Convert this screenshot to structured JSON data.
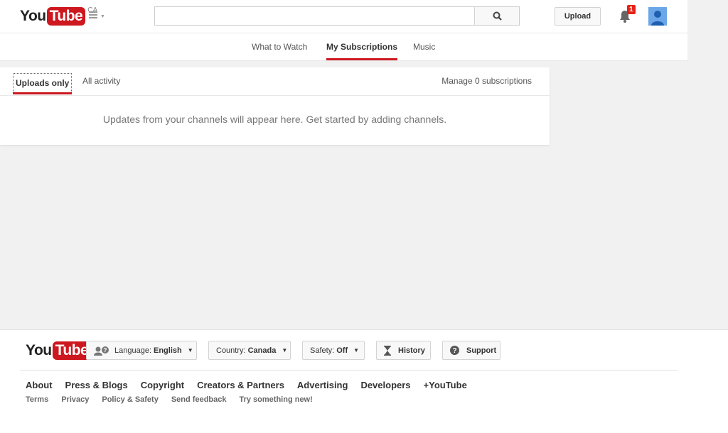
{
  "brand": {
    "logo_you": "You",
    "logo_tube": "Tube",
    "region": "CA"
  },
  "header": {
    "search_placeholder": "",
    "upload_label": "Upload",
    "notification_count": "1"
  },
  "topnav": {
    "tabs": [
      {
        "label": "What to Watch"
      },
      {
        "label": "My Subscriptions",
        "active": true
      },
      {
        "label": "Music"
      }
    ]
  },
  "subscriptions": {
    "tabs": [
      {
        "label": "Uploads only",
        "active": true
      },
      {
        "label": "All activity"
      }
    ],
    "manage_label": "Manage 0 subscriptions",
    "empty_message": "Updates from your channels will appear here. Get started by adding channels."
  },
  "footer": {
    "language_label": "Language:",
    "language_value": "English",
    "country_label": "Country:",
    "country_value": "Canada",
    "safety_label": "Safety:",
    "safety_value": "Off",
    "history_label": "History",
    "support_label": "Support",
    "primary_links": [
      "About",
      "Press & Blogs",
      "Copyright",
      "Creators & Partners",
      "Advertising",
      "Developers",
      "+YouTube"
    ],
    "secondary_links": [
      "Terms",
      "Privacy",
      "Policy & Safety",
      "Send feedback",
      "Try something new!"
    ]
  },
  "colors": {
    "brand_red": "#cc181e",
    "background": "#f1f1f1",
    "notification_red": "#e62117"
  }
}
